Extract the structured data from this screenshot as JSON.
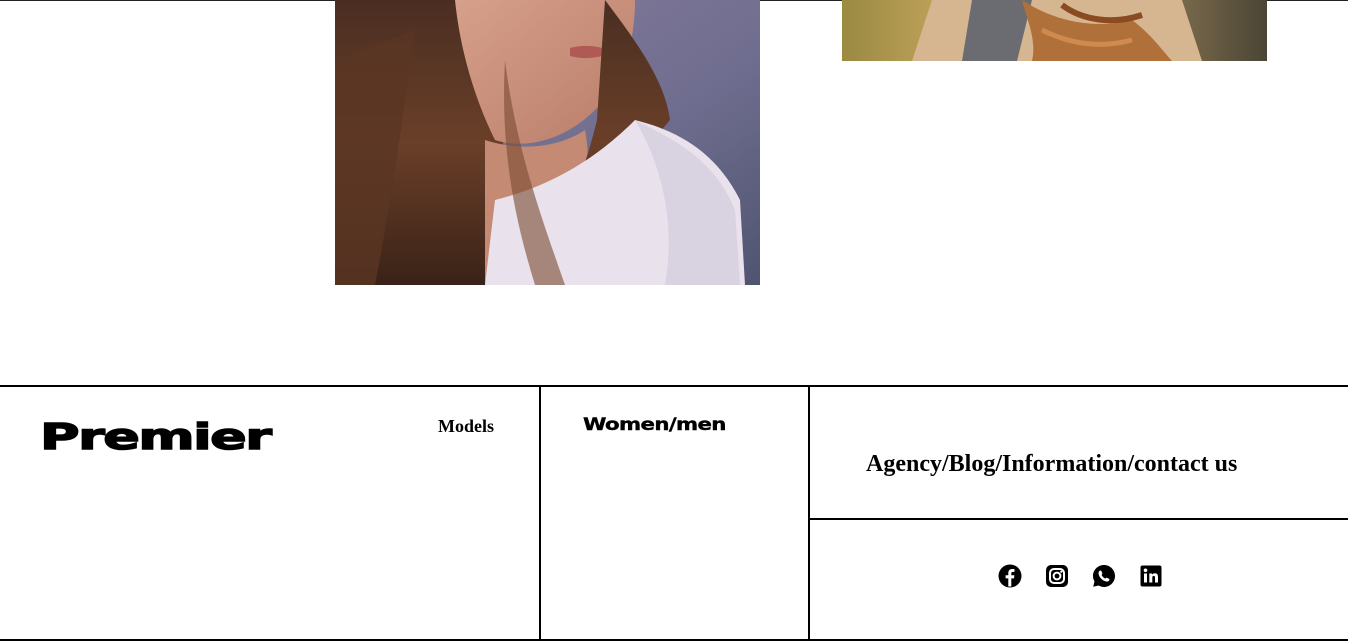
{
  "gallery": {
    "photos": [
      {
        "alt": "woman-with-wavy-hair-portrait"
      },
      {
        "alt": "woman-in-beige-coat-portrait"
      }
    ]
  },
  "footer": {
    "logo": "Premier",
    "models_label": "Models",
    "women_men_label": "Women/men",
    "nav_links": "Agency/Blog/Information/contact us",
    "social": [
      {
        "icon": "facebook-icon"
      },
      {
        "icon": "instagram-icon"
      },
      {
        "icon": "whatsapp-icon"
      },
      {
        "icon": "linkedin-icon"
      }
    ]
  },
  "colors": {
    "text": "#000000",
    "background": "#ffffff",
    "rule": "#000000"
  }
}
